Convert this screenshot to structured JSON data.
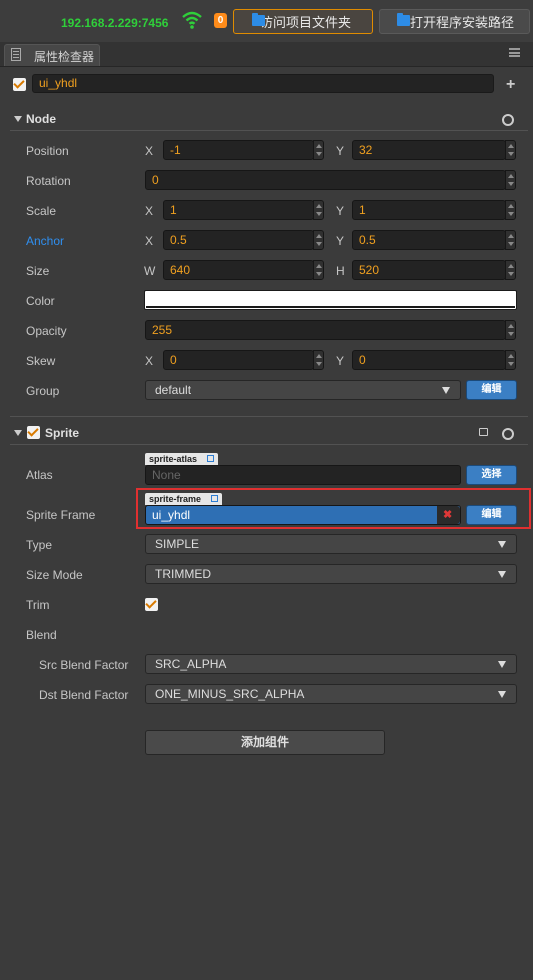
{
  "toolbar": {
    "ip": "192.168.2.229:7456",
    "badge": "0",
    "open_folder_label": "访问项目文件夹",
    "install_path_label": "打开程序安装路径"
  },
  "panel": {
    "title": "属性检查器"
  },
  "node_name": {
    "value": "ui_yhdl",
    "active": true
  },
  "node": {
    "header": "Node",
    "position": {
      "label": "Position",
      "x_axis": "X",
      "x": "-1",
      "y_axis": "Y",
      "y": "32"
    },
    "rotation": {
      "label": "Rotation",
      "value": "0"
    },
    "scale": {
      "label": "Scale",
      "x_axis": "X",
      "x": "1",
      "y_axis": "Y",
      "y": "1"
    },
    "anchor": {
      "label": "Anchor",
      "x_axis": "X",
      "x": "0.5",
      "y_axis": "Y",
      "y": "0.5"
    },
    "size": {
      "label": "Size",
      "w_axis": "W",
      "w": "640",
      "h_axis": "H",
      "h": "520"
    },
    "color": {
      "label": "Color",
      "value": "#ffffff"
    },
    "opacity": {
      "label": "Opacity",
      "value": "255"
    },
    "skew": {
      "label": "Skew",
      "x_axis": "X",
      "x": "0",
      "y_axis": "Y",
      "y": "0"
    },
    "group": {
      "label": "Group",
      "value": "default",
      "edit_label": "编辑"
    }
  },
  "sprite": {
    "header": "Sprite",
    "enabled": true,
    "atlas": {
      "label": "Atlas",
      "tag": "sprite-atlas",
      "placeholder": "None",
      "button": "选择"
    },
    "sprite_frame": {
      "label": "Sprite Frame",
      "tag": "sprite-frame",
      "value": "ui_yhdl",
      "clear": "✖",
      "button": "编辑"
    },
    "type": {
      "label": "Type",
      "value": "SIMPLE"
    },
    "size_mode": {
      "label": "Size Mode",
      "value": "TRIMMED"
    },
    "trim": {
      "label": "Trim",
      "checked": true
    },
    "blend": {
      "label": "Blend"
    },
    "src_blend": {
      "label": "Src Blend Factor",
      "value": "SRC_ALPHA"
    },
    "dst_blend": {
      "label": "Dst Blend Factor",
      "value": "ONE_MINUS_SRC_ALPHA"
    }
  },
  "add_component_label": "添加组件",
  "colors": {
    "accent": "#f0a020",
    "anchor_label": "#2f8ff0",
    "ip": "#2fcf3a",
    "highlight": "#e03030",
    "button_blue": "#3b7fc4"
  }
}
